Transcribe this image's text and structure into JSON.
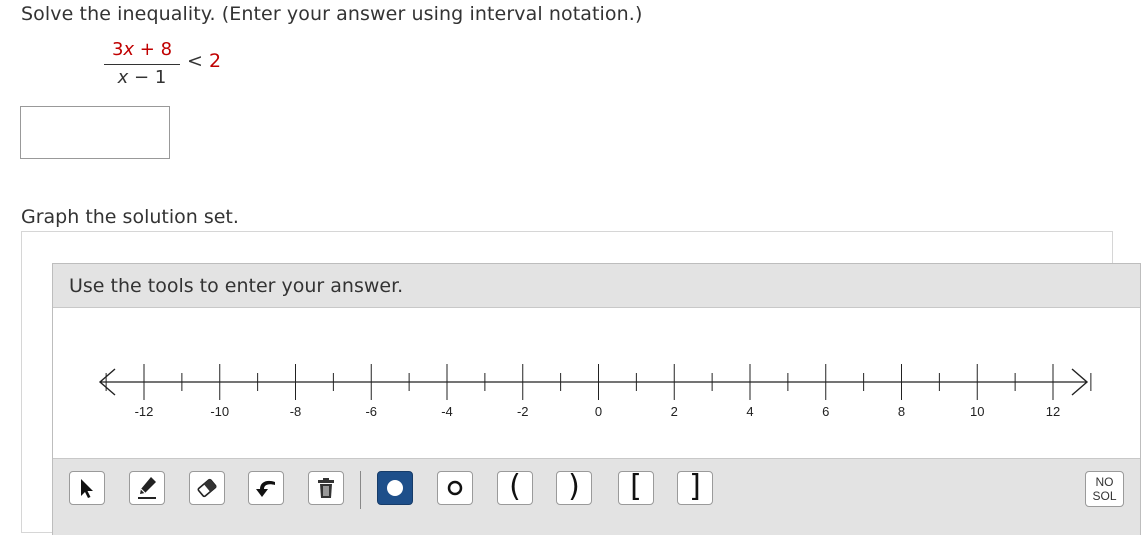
{
  "question": {
    "text": "Solve the inequality. (Enter your answer using interval notation.)",
    "numerator_coef": "3",
    "numerator_var": "x",
    "numerator_rest": " + 8",
    "denominator_var": "x",
    "denominator_rest": " − 1",
    "operator": "< ",
    "rhs": "2"
  },
  "answer_input": {
    "value": "",
    "placeholder": ""
  },
  "graph": {
    "prompt": "Graph the solution set.",
    "panel_header": "Use the tools to enter your answer.",
    "number_line": {
      "min": -13,
      "max": 13,
      "labels": [
        "-12",
        "-10",
        "-8",
        "-6",
        "-4",
        "-2",
        "0",
        "2",
        "4",
        "6",
        "8",
        "10",
        "12"
      ]
    },
    "tools": [
      {
        "name": "pointer-tool",
        "icon": "pointer-icon"
      },
      {
        "name": "pencil-tool",
        "icon": "pencil-icon"
      },
      {
        "name": "eraser-tool",
        "icon": "eraser-icon"
      },
      {
        "name": "undo-tool",
        "icon": "undo-icon"
      },
      {
        "name": "delete-tool",
        "icon": "trash-icon"
      },
      {
        "name": "closed-point-tool",
        "icon": "closed-dot-icon",
        "active": true
      },
      {
        "name": "open-point-tool",
        "icon": "open-dot-icon"
      },
      {
        "name": "left-paren-tool",
        "glyph": "("
      },
      {
        "name": "right-paren-tool",
        "glyph": ")"
      },
      {
        "name": "left-bracket-tool",
        "glyph": "["
      },
      {
        "name": "right-bracket-tool",
        "glyph": "]"
      }
    ],
    "no_solution_top": "NO",
    "no_solution_bottom": "SOL"
  },
  "colors": {
    "accent_red": "#c00000",
    "active_tool": "#1e4f8a",
    "panel_gray": "#e3e3e3"
  }
}
